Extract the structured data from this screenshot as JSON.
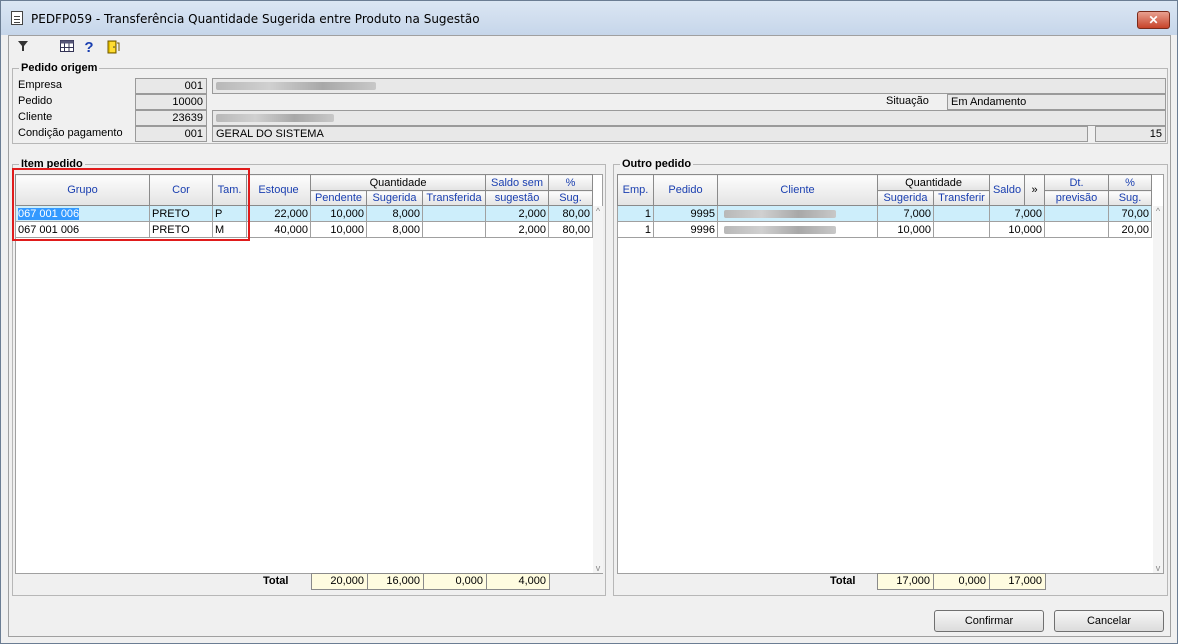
{
  "window": {
    "title": "PEDFP059 - Transferência Quantidade Sugerida entre Produto na Sugestão",
    "close_glyph": "✕"
  },
  "toolbar": {
    "icons": [
      "filter-icon",
      "calendar-grid-icon",
      "help-icon",
      "exit-door-icon"
    ],
    "help_glyph": "?"
  },
  "pedido_origem": {
    "label": "Pedido origem",
    "empresa_label": "Empresa",
    "empresa_code": "001",
    "pedido_label": "Pedido",
    "pedido_value": "10000",
    "situacao_label": "Situação",
    "situacao_value": "Em Andamento",
    "cliente_label": "Cliente",
    "cliente_code": "23639",
    "condicao_label": "Condição pagamento",
    "condicao_code": "001",
    "condicao_desc": "GERAL DO SISTEMA",
    "condicao_extra": "15"
  },
  "item_pedido": {
    "label": "Item pedido",
    "headers": {
      "grupo": "Grupo",
      "cor": "Cor",
      "tam": "Tam.",
      "estoque": "Estoque",
      "quantidade": "Quantidade",
      "pendente": "Pendente",
      "sugerida": "Sugerida",
      "transferida": "Transferida",
      "saldo_sem": "Saldo sem",
      "sugestao": "sugestão",
      "pct": "%",
      "sug": "Sug."
    },
    "rows": [
      {
        "grupo": "067 001 006",
        "cor": "PRETO",
        "tam": "P",
        "estoque": "22,000",
        "pendente": "10,000",
        "sugerida": "8,000",
        "transferida": "",
        "saldo": "2,000",
        "pct": "80,00"
      },
      {
        "grupo": "067 001 006",
        "cor": "PRETO",
        "tam": "M",
        "estoque": "40,000",
        "pendente": "10,000",
        "sugerida": "8,000",
        "transferida": "",
        "saldo": "2,000",
        "pct": "80,00"
      }
    ],
    "total_label": "Total",
    "totals": {
      "pendente": "20,000",
      "sugerida": "16,000",
      "transferida": "0,000",
      "saldo": "4,000"
    }
  },
  "outro_pedido": {
    "label": "Outro pedido",
    "headers": {
      "emp": "Emp.",
      "pedido": "Pedido",
      "cliente": "Cliente",
      "quantidade": "Quantidade",
      "sugerida": "Sugerida",
      "transferir": "Transferir",
      "saldo": "Saldo",
      "arrow": "»",
      "dt": "Dt.",
      "previsao": "previsão",
      "pct": "%",
      "sug": "Sug."
    },
    "rows": [
      {
        "emp": "1",
        "pedido": "9995",
        "sugerida": "7,000",
        "transferir": "",
        "saldo": "7,000",
        "dt": "",
        "pct": "70,00"
      },
      {
        "emp": "1",
        "pedido": "9996",
        "sugerida": "10,000",
        "transferir": "",
        "saldo": "10,000",
        "dt": "",
        "pct": "20,00"
      }
    ],
    "total_label": "Total",
    "totals": {
      "sugerida": "17,000",
      "transferir": "0,000",
      "saldo": "17,000"
    }
  },
  "buttons": {
    "confirmar": "Confirmar",
    "cancelar": "Cancelar"
  },
  "colors": {
    "selected_row": "#cdeefb",
    "highlight_box": "#e01b1b",
    "total_field": "#fffce0",
    "header_text": "#1a3fb0"
  }
}
